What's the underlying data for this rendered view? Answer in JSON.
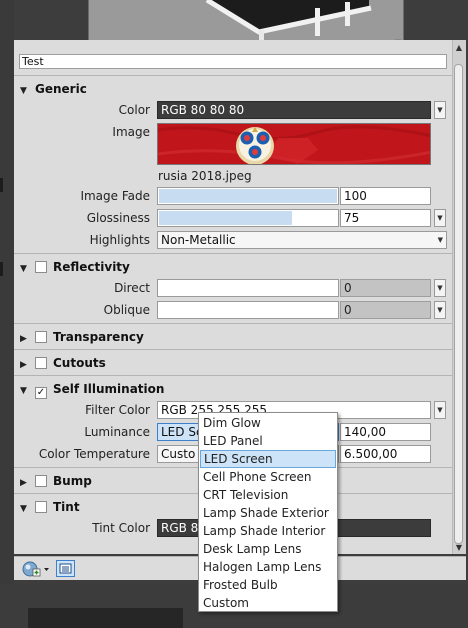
{
  "material_name": "Test",
  "sections": {
    "generic": "Generic",
    "reflectivity": "Reflectivity",
    "transparency": "Transparency",
    "cutouts": "Cutouts",
    "self_illumination": "Self Illumination",
    "bump": "Bump",
    "tint": "Tint"
  },
  "generic": {
    "color_label": "Color",
    "color_value": "RGB 80 80 80",
    "image_label": "Image",
    "image_filename": "rusia 2018.jpeg",
    "image_fade_label": "Image Fade",
    "image_fade_value": "100",
    "image_fade_fraction": 1.0,
    "glossiness_label": "Glossiness",
    "glossiness_value": "75",
    "glossiness_fraction": 0.75,
    "highlights_label": "Highlights",
    "highlights_value": "Non-Metallic"
  },
  "reflectivity": {
    "enabled": false,
    "direct_label": "Direct",
    "direct_value": "0",
    "oblique_label": "Oblique",
    "oblique_value": "0"
  },
  "transparency": {
    "enabled": false
  },
  "cutouts": {
    "enabled": false
  },
  "self_illumination": {
    "enabled": true,
    "filter_color_label": "Filter Color",
    "filter_color_value": "RGB 255 255 255",
    "luminance_label": "Luminance",
    "luminance_select": "LED Sc",
    "luminance_value": "140,00",
    "color_temp_label": "Color Temperature",
    "color_temp_select": "Custo",
    "color_temp_value": "6.500,00"
  },
  "bump": {
    "enabled": false
  },
  "tint": {
    "enabled": false,
    "tint_color_label": "Tint Color",
    "tint_color_value": "RGB 80"
  },
  "luminance_menu": {
    "items": [
      "Dim Glow",
      "LED Panel",
      "LED Screen",
      "Cell Phone Screen",
      "CRT Television",
      "Lamp Shade Exterior",
      "Lamp Shade Interior",
      "Desk Lamp Lens",
      "Halogen Lamp Lens",
      "Frosted Bulb",
      "Custom"
    ],
    "highlighted": "LED Screen"
  },
  "colors": {
    "panel": "#dcdcdc",
    "dark_chrome": "#3c3c3c",
    "selection": "#cde3f7",
    "slider_fill": "#c7dcf0",
    "image_red": "#c0161b"
  },
  "icons": [
    "checkmark-icon",
    "triangle-down-icon",
    "triangle-right-icon",
    "chevron-down-icon",
    "add-material-icon",
    "list-view-icon"
  ]
}
